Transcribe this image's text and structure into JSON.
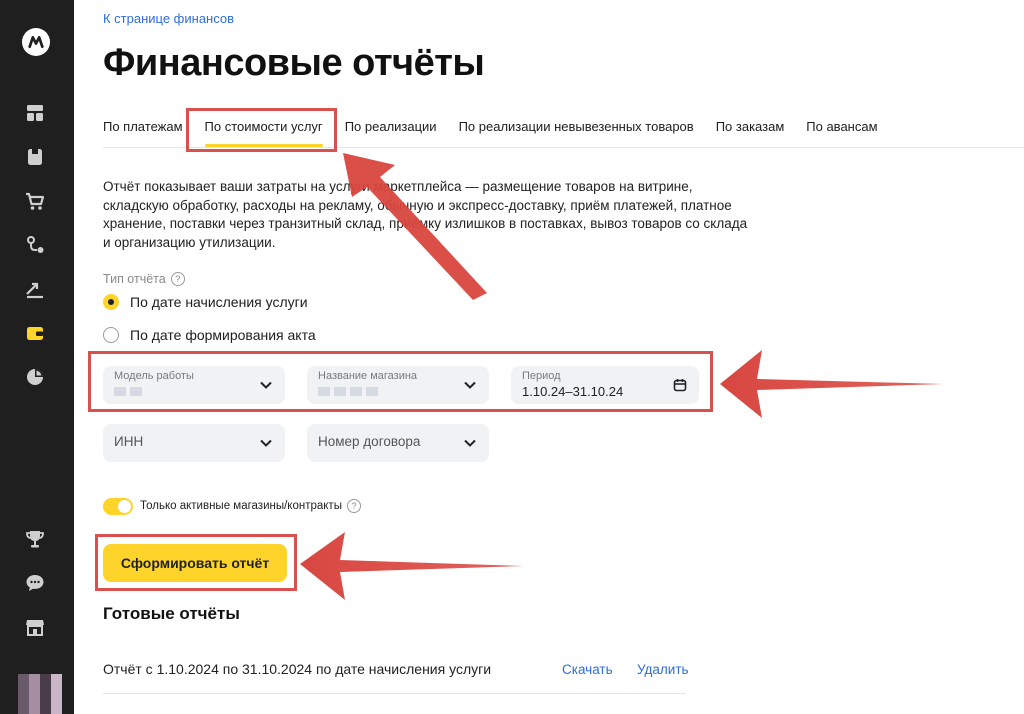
{
  "breadcrumb": "К странице финансов",
  "page_title": "Финансовые отчёты",
  "tabs": [
    {
      "label": "По платежам",
      "active": false
    },
    {
      "label": "По стоимости услуг",
      "active": true
    },
    {
      "label": "По реализации",
      "active": false
    },
    {
      "label": "По реализации невывезенных товаров",
      "active": false
    },
    {
      "label": "По заказам",
      "active": false
    },
    {
      "label": "По авансам",
      "active": false
    }
  ],
  "description": "Отчёт показывает ваши затраты на услуги маркетплейса — размещение товаров на витрине, складскую обработку, расходы на рекламу, обычную и экспресс-доставку, приём платежей, платное хранение, поставки через транзитный склад, приёмку излишков в поставках, вывоз товаров со склада и организацию утилизации.",
  "report_type": {
    "label": "Тип отчёта",
    "options": [
      {
        "label": "По дате начисления услуги",
        "selected": true
      },
      {
        "label": "По дате формирования акта",
        "selected": false
      }
    ]
  },
  "filters": {
    "work_model": {
      "label": "Модель работы"
    },
    "shop_name": {
      "label": "Название магазина"
    },
    "period": {
      "label": "Период",
      "value": "1.10.24–31.10.24"
    },
    "inn": {
      "placeholder": "ИНН"
    },
    "contract": {
      "placeholder": "Номер договора"
    }
  },
  "toggle": {
    "label": "Только активные магазины/контракты",
    "on": true
  },
  "generate_button": "Сформировать отчёт",
  "ready_reports": {
    "title": "Готовые отчёты",
    "items": [
      {
        "name": "Отчёт с 1.10.2024 по 31.10.2024 по дате начисления услуги",
        "download": "Скачать",
        "delete": "Удалить"
      }
    ]
  },
  "sidebar_icons": [
    "market-logo-icon",
    "dashboard-icon",
    "products-icon",
    "cart-icon",
    "logistics-icon",
    "growth-icon",
    "wallet-icon",
    "analytics-pie-icon",
    "trophy-icon",
    "chat-icon",
    "store-icon"
  ],
  "colors": {
    "accent": "#fed42b",
    "link": "#2e6edc",
    "annotation": "#d9514e",
    "sidebar": "#1f1f1f"
  }
}
